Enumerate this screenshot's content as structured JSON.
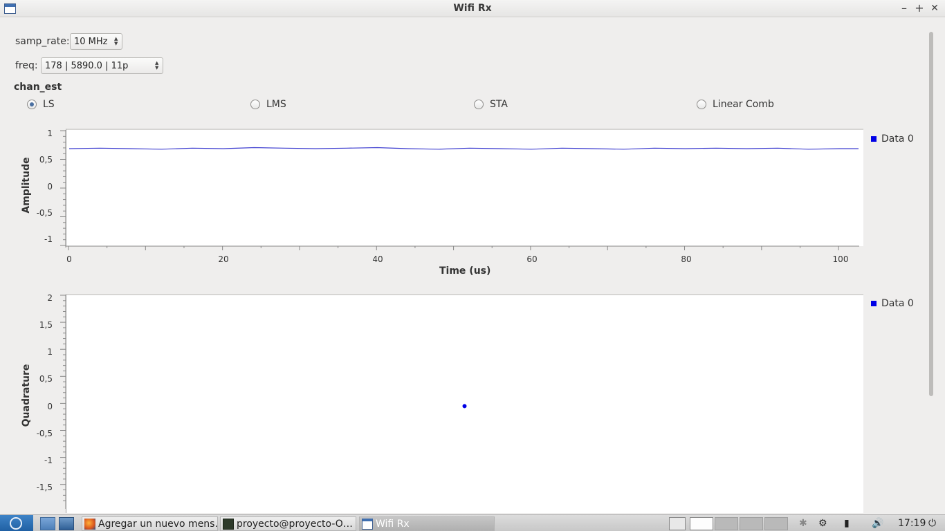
{
  "window": {
    "title": "Wifi Rx",
    "controls": {
      "minimize": "–",
      "maximize": "+",
      "close": "✕"
    }
  },
  "controls": {
    "samp_rate": {
      "label": "samp_rate:",
      "value": "10 MHz"
    },
    "freq": {
      "label": "freq:",
      "value": "178 | 5890.0 | 11p"
    },
    "chan_est": {
      "title": "chan_est",
      "options": [
        "LS",
        "LMS",
        "STA",
        "Linear Comb"
      ],
      "selected": "LS"
    }
  },
  "plots": {
    "time": {
      "ylabel": "Amplitude",
      "xlabel": "Time (us)",
      "legend": "Data 0",
      "yticks": [
        "1",
        "0,5",
        "0",
        "-0,5",
        "-1"
      ],
      "xticks": [
        "0",
        "20",
        "40",
        "60",
        "80",
        "100"
      ]
    },
    "constellation": {
      "ylabel": "Quadrature",
      "legend": "Data 0",
      "yticks": [
        "2",
        "1,5",
        "1",
        "0,5",
        "0",
        "-0,5",
        "-1",
        "-1,5"
      ]
    }
  },
  "chart_data": [
    {
      "type": "line",
      "xlabel": "Time (us)",
      "ylabel": "Amplitude",
      "xlim": [
        0,
        102.5
      ],
      "ylim": [
        -1,
        1
      ],
      "series": [
        {
          "name": "Data 0",
          "x": [
            0,
            4,
            8,
            12,
            16,
            20,
            24,
            28,
            32,
            36,
            40,
            44,
            48,
            52,
            56,
            60,
            64,
            68,
            72,
            76,
            80,
            84,
            88,
            92,
            96,
            100,
            102.5
          ],
          "values": [
            0.71,
            0.72,
            0.71,
            0.7,
            0.72,
            0.71,
            0.73,
            0.72,
            0.71,
            0.72,
            0.73,
            0.71,
            0.7,
            0.72,
            0.71,
            0.7,
            0.72,
            0.71,
            0.7,
            0.72,
            0.71,
            0.72,
            0.71,
            0.72,
            0.7,
            0.71,
            0.71
          ]
        }
      ],
      "color": "#3f3fd0"
    },
    {
      "type": "scatter",
      "ylabel": "Quadrature",
      "ylim": [
        -1.8,
        2.0
      ],
      "xlim": [
        -2,
        2
      ],
      "series": [
        {
          "name": "Data 0",
          "points": [
            [
              0,
              0
            ]
          ]
        }
      ],
      "color": "#0000e6"
    }
  ],
  "taskbar": {
    "tasks": [
      {
        "label": "Agregar un nuevo mens…",
        "active": false
      },
      {
        "label": "proyecto@proyecto-O…",
        "active": false
      },
      {
        "label": "Wifi Rx",
        "active": true
      }
    ],
    "clock": "17:19"
  }
}
